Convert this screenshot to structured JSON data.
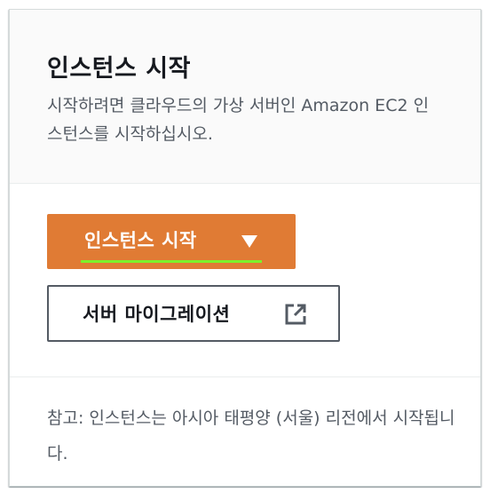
{
  "header": {
    "title": "인스턴스 시작",
    "description": "시작하려면 클라우드의 가상 서버인 Amazon EC2 인스턴스를 시작하십시오."
  },
  "actions": {
    "launch_label": "인스턴스 시작",
    "launch_icon": "caret-down-icon",
    "migrate_label": "서버 마이그레이션",
    "migrate_icon": "external-link-icon"
  },
  "footer": {
    "note": "참고: 인스턴스는 아시아 태평양 (서울) 리전에서 시작됩니다."
  },
  "colors": {
    "primary_button": "#e07b34",
    "focus_ring": "#7cf22b",
    "text_dark": "#16191f",
    "text_muted": "#545b64"
  }
}
